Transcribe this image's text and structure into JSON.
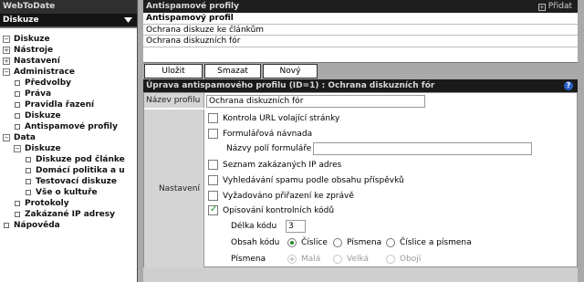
{
  "app": {
    "title": "WebToDate"
  },
  "module": {
    "name": "Diskuze"
  },
  "tree": [
    {
      "label": "Diskuze",
      "toggle": "-"
    },
    {
      "label": "Nástroje",
      "toggle": "+"
    },
    {
      "label": "Nastavení",
      "toggle": "+"
    },
    {
      "label": "Administrace",
      "toggle": "-"
    },
    {
      "label": "Předvolby"
    },
    {
      "label": "Práva"
    },
    {
      "label": "Pravidla řazení"
    },
    {
      "label": "Diskuze"
    },
    {
      "label": "Antispamové profily"
    },
    {
      "label": "Data",
      "toggle": "-"
    },
    {
      "label": "Diskuze",
      "toggle": "-"
    },
    {
      "label": "Diskuze pod článke"
    },
    {
      "label": "Domácí politika a u"
    },
    {
      "label": "Testovací diskuze"
    },
    {
      "label": "Vše o kultuře"
    },
    {
      "label": "Protokoly"
    },
    {
      "label": "Zakázané IP adresy"
    },
    {
      "label": "Nápověda"
    }
  ],
  "profiles_section": {
    "title": "Antispamové profily",
    "add_label": "Přidat",
    "column_header": "Antispamový profil",
    "rows": [
      "Ochrana diskuze ke článkům",
      "Ochrana diskuzních fór"
    ]
  },
  "toolbar": {
    "save": "Uložit",
    "delete": "Smazat",
    "new": "Nový"
  },
  "edit": {
    "header": "Úprava antispamového profilu (ID=1) : Ochrana diskuzních fór",
    "help_icon": "?",
    "name_label": "Název profilu",
    "name_value": "Ochrana diskuzních fór",
    "settings_label": "Nastavení",
    "options": {
      "url_check": "Kontrola URL volající stránky",
      "honeypot": "Formulářová návnada",
      "honeypot_fields_label": "Názvy polí formuláře",
      "ip_list": "Seznam zakázaných IP adres",
      "content_search": "Vyhledávání spamu podle obsahu příspěvků",
      "assign_required": "Vyžadováno přiřazení ke zprávě",
      "captcha": "Opisování kontrolních kódů"
    },
    "code_length_label": "Délka kódu",
    "code_length_value": "3",
    "code_content_label": "Obsah kódu",
    "code_content_options": [
      "Číslice",
      "Písmena",
      "Číslice a písmena"
    ],
    "letters_label": "Písmena",
    "letters_options": [
      "Malá",
      "Velká",
      "Obojí"
    ]
  }
}
